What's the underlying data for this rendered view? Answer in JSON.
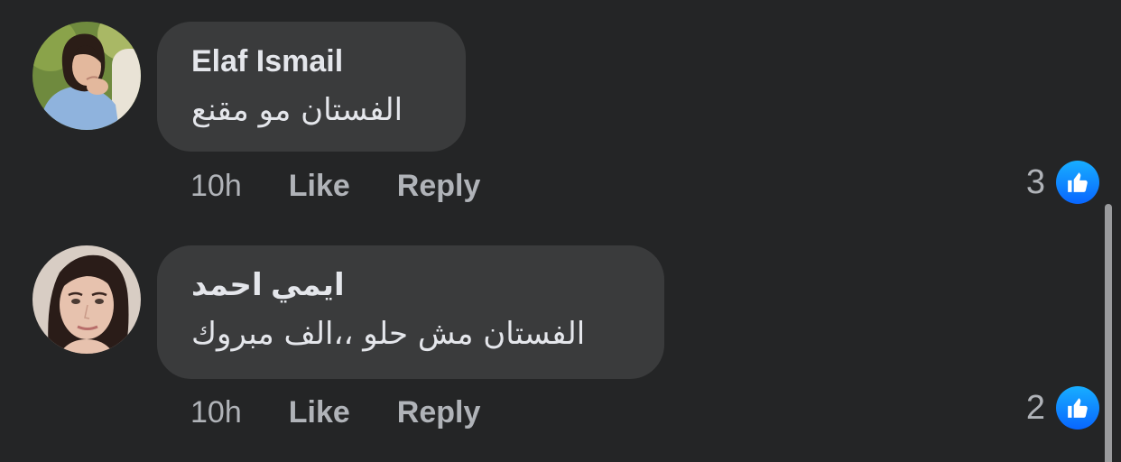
{
  "comments": [
    {
      "author": "Elaf Ismail",
      "text": "الفستان مو مقنع",
      "time": "10h",
      "like_label": "Like",
      "reply_label": "Reply",
      "reaction_count": "3",
      "reaction_icon": "thumbs-up-icon"
    },
    {
      "author": "ايمي احمد",
      "text": "الفستان مش حلو ،،الف مبروك",
      "time": "10h",
      "like_label": "Like",
      "reply_label": "Reply",
      "reaction_count": "2",
      "reaction_icon": "thumbs-up-icon"
    }
  ],
  "colors": {
    "background": "#242526",
    "bubble": "#3a3b3c",
    "primary_text": "#e4e6eb",
    "secondary_text": "#b0b3b8",
    "like_blue": "#0866ff"
  }
}
